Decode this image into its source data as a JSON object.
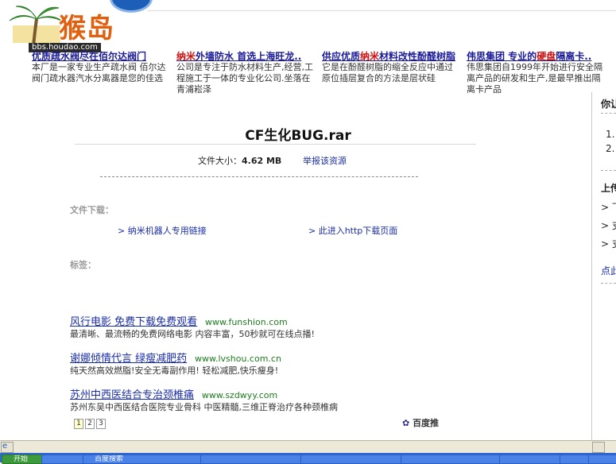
{
  "header": {
    "logo_text": "猴岛",
    "logo_url": "bbs.houdao.com"
  },
  "ads_top": [
    {
      "title": "优质疏水阀尽在佰尔达阀门",
      "title_red": "",
      "desc": "本厂是一家专业生产疏水阀 佰尔达阀门疏水器汽水分离器是您的佳选"
    },
    {
      "title_pre": "",
      "title_red": "纳米",
      "title": "外墙防水 首选上海旺龙..",
      "desc": "公司是专注于防水材料生产,经营,工程施工于一体的专业化公司.坐落在青浦崧泽"
    },
    {
      "title_pre": "供应优质",
      "title_red": "纳米",
      "title": "材料改性酚醛树脂",
      "desc": "它是在酚醛树脂的缩全反应中通过原位插层复合的方法是层状硅"
    },
    {
      "title_pre": "伟思集团 专业的",
      "title_red": "硬盘",
      "title": "隔离卡..",
      "desc": "伟思集团自1999年开始进行安全隔离产品的研发和生产,是最早推出隔离卡产品"
    }
  ],
  "file": {
    "name": "CF生化BUG.rar",
    "size_label": "文件大小：",
    "size_value": "4.62 MB",
    "report_label": "举报该资源"
  },
  "download": {
    "label": "文件下载：",
    "link1": "> 纳米机器人专用链接",
    "link2": "> 此进入http下载页面"
  },
  "tags": {
    "label": "标签："
  },
  "ads_bottom": [
    {
      "title": "风行电影 免费下载免费观看",
      "url": "www.funshion.com",
      "desc": "最清晰、最流畅的免费网络电影 内容丰富，50秒就可在线点播!"
    },
    {
      "title": "谢娜倾情代言 绿瘦减肥药",
      "url": "www.lvshou.com.cn",
      "desc": "纯天然高效燃脂!安全无毒副作用! 轻松减肥,快乐瘦身!"
    },
    {
      "title": "苏州中西医结合专治颈椎痛",
      "url": "www.szdwyy.com",
      "desc": "苏州东吴中西医结合医院专业骨科 中医精髓,三维正脊治疗各种颈椎病"
    }
  ],
  "pager": [
    "1",
    "2",
    "3"
  ],
  "baidu_label": "百度推",
  "right_col": {
    "head1": "你让",
    "item1": "1.",
    "item2": "2.",
    "head2": "上传",
    "b1": "> 下",
    "b2": "> 支",
    "b3": "> 支",
    "link": "点此"
  },
  "taskbar": [
    "开始",
    "",
    "百度搜索",
    "",
    "",
    "",
    "",
    "",
    ""
  ]
}
